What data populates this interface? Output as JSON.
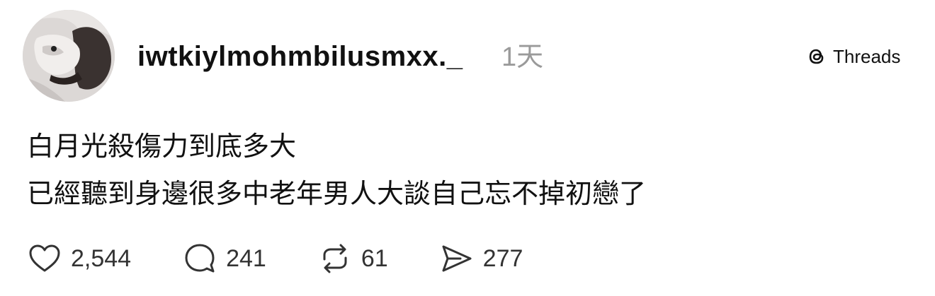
{
  "post": {
    "username": "iwtkiylmohmbilusmxx._",
    "time": "1天",
    "brand": {
      "label": "Threads",
      "icon": "threads-logo-icon"
    },
    "text_lines": [
      "白月光殺傷力到底多大",
      "已經聽到身邊很多中老年男人大談自己忘不掉初戀了"
    ],
    "actions": {
      "likes": {
        "icon": "heart-icon",
        "count": "2,544"
      },
      "replies": {
        "icon": "comment-icon",
        "count": "241"
      },
      "reposts": {
        "icon": "repost-icon",
        "count": "61"
      },
      "shares": {
        "icon": "share-icon",
        "count": "277"
      }
    }
  },
  "colors": {
    "text": "#111111",
    "muted": "#9a9a9a",
    "count": "#333333",
    "background": "#ffffff"
  }
}
